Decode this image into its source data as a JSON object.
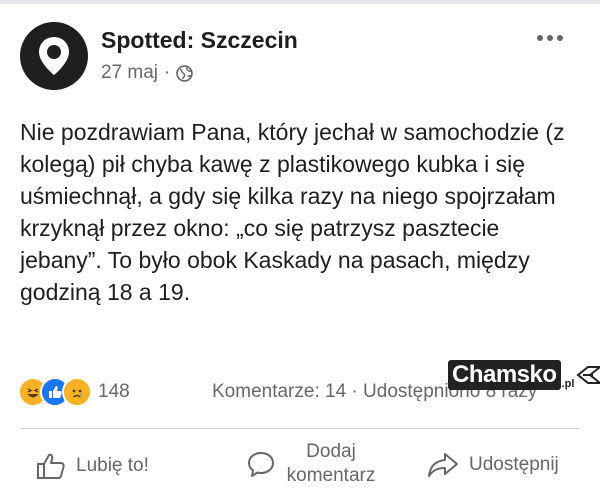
{
  "post": {
    "page_name": "Spotted: Szczecin",
    "date": "27 maj",
    "separator": "·",
    "text": "Nie pozdrawiam Pana, który jechał w samochodzie (z kolegą) pił chyba kawę z plastikowego kubka i się uśmiechnął, a gdy się kilka razy na niego spojrzałam krzyknął przez okno: „co się patrzysz pasztecie jebany”. To było obok Kaskady na pasach, między godziną 18 a 19."
  },
  "icons": {
    "avatar": "map-pin-icon",
    "privacy": "globe-icon",
    "more": "more-dots-icon",
    "reactions": [
      "haha-icon",
      "like-icon",
      "sad-icon"
    ],
    "like": "thumb-up-icon",
    "comment": "comment-bubble-icon",
    "share": "share-arrow-icon"
  },
  "stats": {
    "reaction_count": "148",
    "comments": "Komentarze: 14",
    "shares": "Udostępniono 8 razy"
  },
  "actions": {
    "like": "Lubię to!",
    "comment_line1": "Dodaj",
    "comment_line2": "komentarz",
    "share": "Udostępnij"
  },
  "watermark": {
    "text": "Chamsko",
    "suffix": ".pl"
  },
  "colors": {
    "text": "#1c1e21",
    "secondary": "#65676b",
    "like_blue": "#1877f2",
    "haha_yellow": "#f7b125"
  }
}
